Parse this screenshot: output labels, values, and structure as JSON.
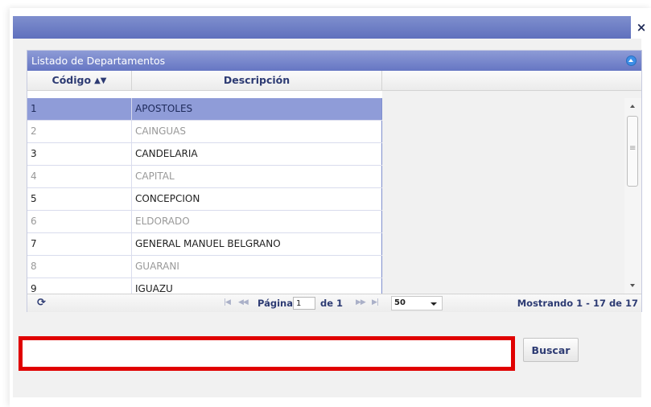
{
  "dialog": {
    "close_symbol": "×"
  },
  "grid": {
    "caption": "Listado de Departamentos",
    "columns": {
      "code": "Código",
      "description": "Descripción"
    },
    "rows": [
      {
        "code": "1",
        "description": "APOSTOLES",
        "selected": true
      },
      {
        "code": "2",
        "description": "CAINGUAS"
      },
      {
        "code": "3",
        "description": "CANDELARIA"
      },
      {
        "code": "4",
        "description": "CAPITAL"
      },
      {
        "code": "5",
        "description": "CONCEPCION"
      },
      {
        "code": "6",
        "description": "ELDORADO"
      },
      {
        "code": "7",
        "description": "GENERAL MANUEL BELGRANO"
      },
      {
        "code": "8",
        "description": "GUARANI"
      },
      {
        "code": "9",
        "description": "IGUAZU"
      }
    ],
    "pager": {
      "page_label": "Página",
      "page_value": "1",
      "of_label": "de 1",
      "rows_per_page": "50",
      "showing": "Mostrando 1 - 17 de 17"
    }
  },
  "search": {
    "value": "",
    "button_label": "Buscar"
  },
  "colors": {
    "accent": "#6676c3",
    "selected_row": "#8f9cd8",
    "highlight_border": "#e00000"
  }
}
